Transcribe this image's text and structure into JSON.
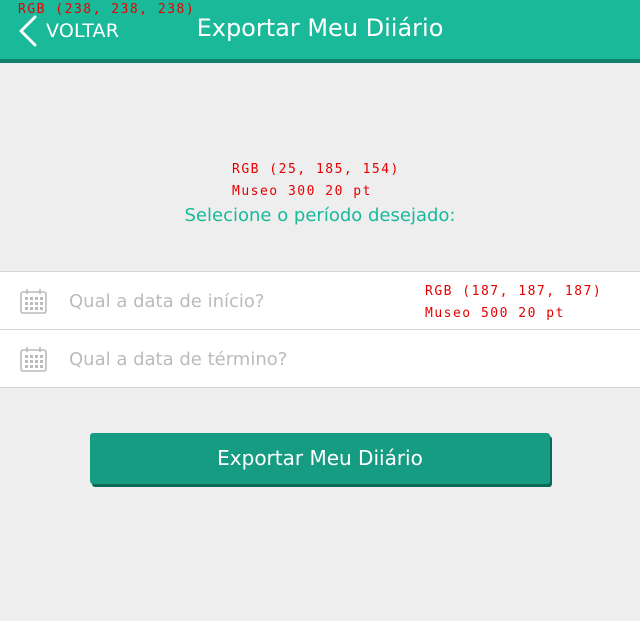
{
  "header": {
    "back_label": "VOLTAR",
    "title": "Exportar Meu Diiário",
    "color_note": "RGB (238, 238, 238)"
  },
  "main": {
    "subtitle": "Selecione o período desejado:",
    "subtitle_note_color": "RGB (25, 185, 154)",
    "subtitle_note_font": "Museo 300 20 pt",
    "field_note_color": "RGB (187, 187, 187)",
    "field_note_font": "Museo 500 20 pt",
    "fields": [
      {
        "placeholder": "Qual a data de início?"
      },
      {
        "placeholder": "Qual a data de término?"
      }
    ],
    "export_button": "Exportar Meu Diiário"
  },
  "colors": {
    "brand": "#19b99a",
    "brand_dark": "#169c82",
    "background": "#eeeeee",
    "placeholder": "#bbbbbb",
    "annotation": "#e60000"
  },
  "icons": [
    "chevron-left-icon",
    "calendar-icon"
  ]
}
